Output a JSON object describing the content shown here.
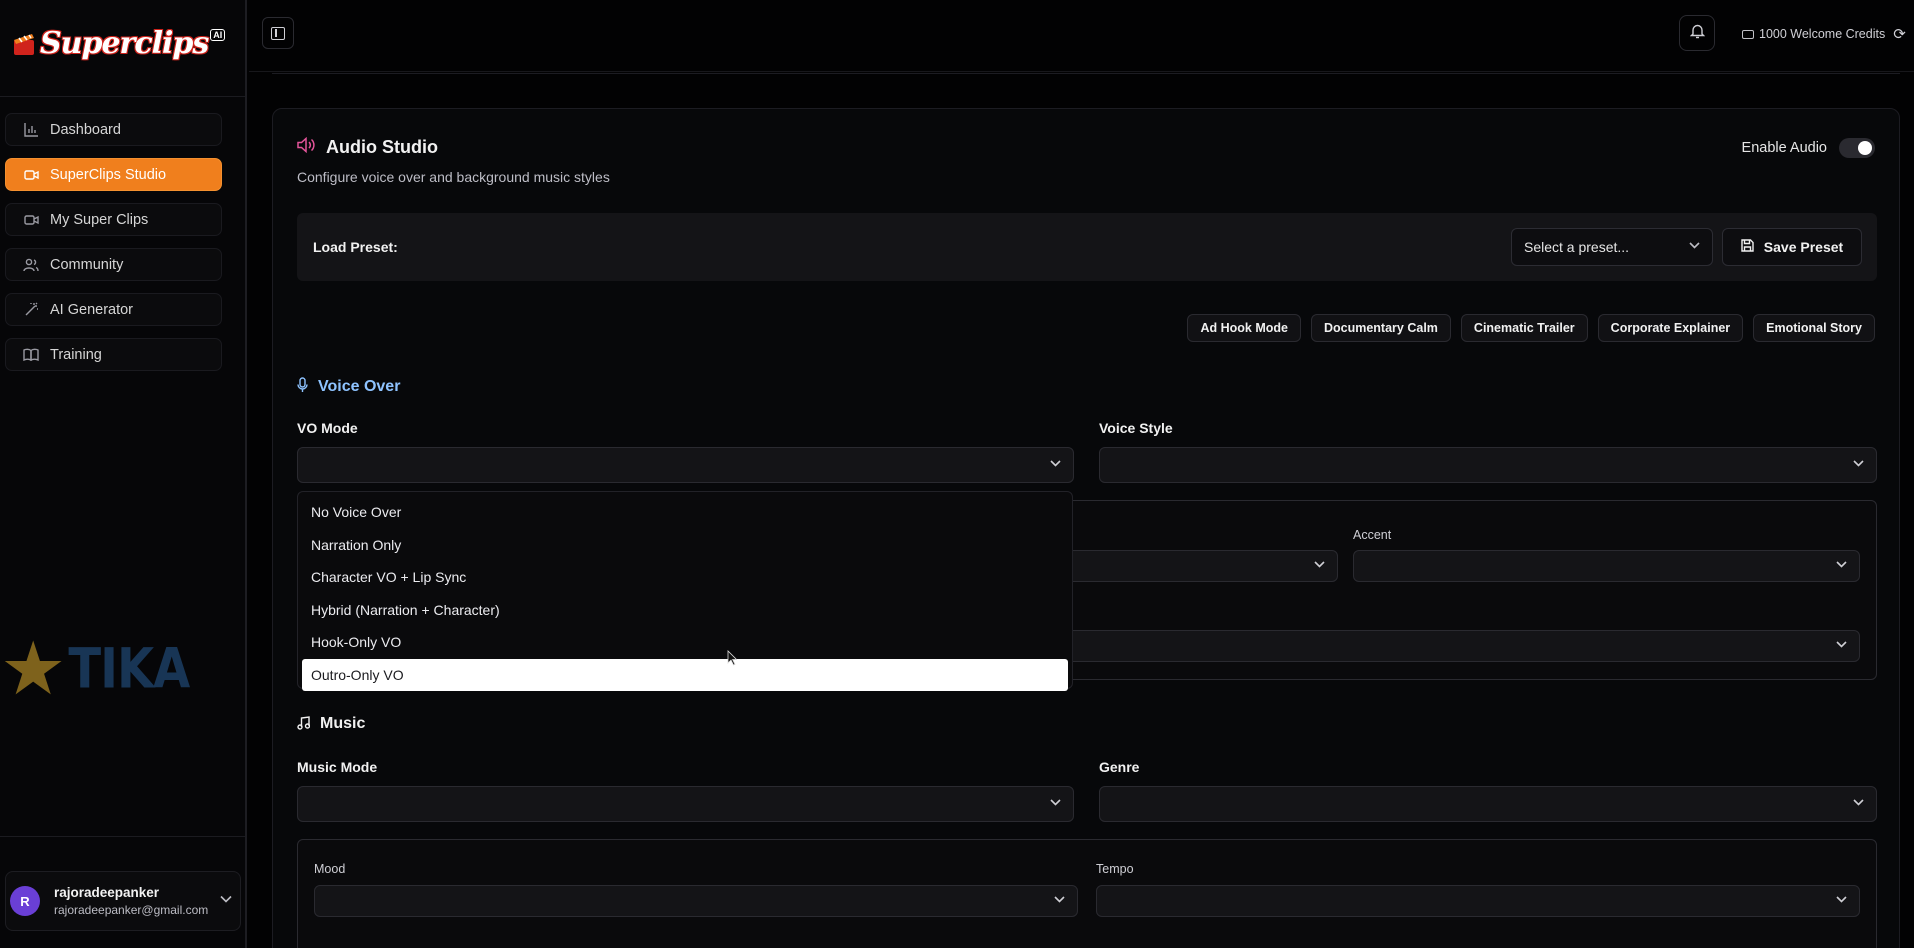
{
  "app": {
    "logo_text": "Superclips",
    "logo_badge": "AI"
  },
  "sidebar": {
    "items": [
      {
        "label": "Dashboard",
        "icon": "bar-chart-icon",
        "active": false
      },
      {
        "label": "SuperClips Studio",
        "icon": "video-camera-icon",
        "active": true
      },
      {
        "label": "My Super Clips",
        "icon": "video-camera-icon",
        "active": false
      },
      {
        "label": "Community",
        "icon": "users-icon",
        "active": false
      },
      {
        "label": "AI Generator",
        "icon": "magic-wand-icon",
        "active": false
      },
      {
        "label": "Training",
        "icon": "book-icon",
        "active": false
      }
    ],
    "user": {
      "initial": "R",
      "name": "rajoradeepanker",
      "email": "rajoradeepanker@gmail.com",
      "avatar_color": "#6a3fd6"
    }
  },
  "topbar": {
    "credits": "1000 Welcome Credits"
  },
  "watermark": {
    "text": "TIKA"
  },
  "audio": {
    "title": "Audio Studio",
    "subtitle": "Configure voice over and background music styles",
    "enable_label": "Enable Audio",
    "enabled": true,
    "preset_label": "Load Preset:",
    "preset_placeholder": "Select a preset...",
    "save_preset": "Save Preset",
    "chips": [
      "Ad Hook Mode",
      "Documentary Calm",
      "Cinematic Trailer",
      "Corporate Explainer",
      "Emotional Story"
    ],
    "accent_color": "#f07f1d"
  },
  "voice_over": {
    "title": "Voice Over",
    "vo_mode_label": "VO Mode",
    "voice_style_label": "Voice Style",
    "accent_label": "Accent",
    "options": [
      "No Voice Over",
      "Narration Only",
      "Character VO + Lip Sync",
      "Hybrid (Narration + Character)",
      "Hook-Only VO",
      "Outro-Only VO"
    ],
    "hovered_option": "Outro-Only VO"
  },
  "music": {
    "title": "Music",
    "mode_label": "Music Mode",
    "genre_label": "Genre",
    "mood_label": "Mood",
    "tempo_label": "Tempo"
  }
}
